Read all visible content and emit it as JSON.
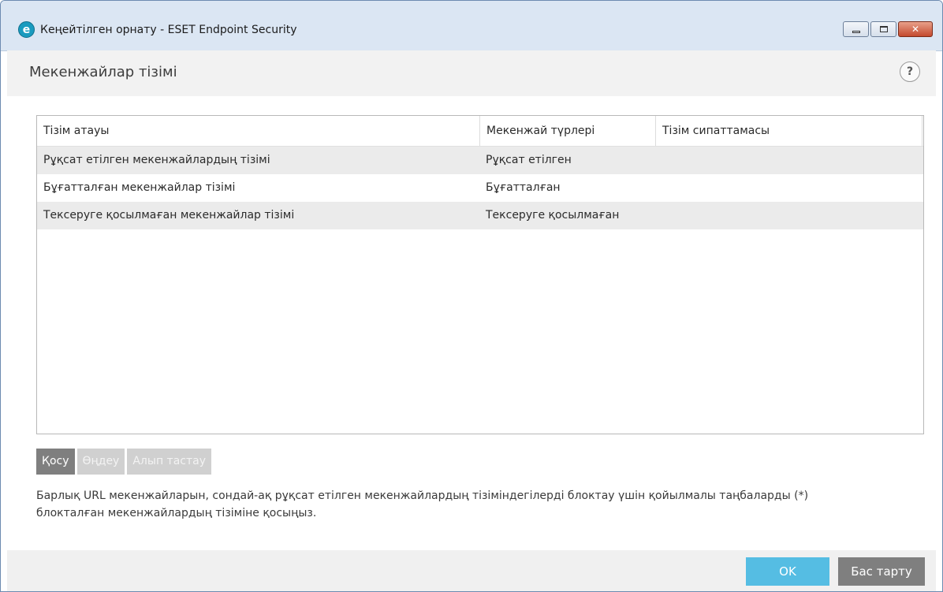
{
  "window": {
    "title": "Кеңейтілген орнату - ESET Endpoint Security",
    "logo_letter": "e",
    "controls": {
      "minimize": "",
      "maximize": "",
      "close": "✕"
    }
  },
  "header": {
    "title": "Мекенжайлар тізімі",
    "help_label": "?"
  },
  "table": {
    "columns": [
      "Тізім атауы",
      "Мекенжай түрлері",
      "Тізім сипаттамасы"
    ],
    "rows": [
      {
        "name": "Рұқсат етілген мекенжайлардың тізімі",
        "type": "Рұқсат етілген",
        "description": ""
      },
      {
        "name": "Бұғатталған мекенжайлар тізімі",
        "type": "Бұғатталған",
        "description": ""
      },
      {
        "name": "Тексеруге қосылмаған мекенжайлар тізімі",
        "type": "Тексеруге қосылмаған",
        "description": ""
      }
    ]
  },
  "actions": {
    "add": "Қосу",
    "edit": "Өңдеу",
    "remove": "Алып тастау"
  },
  "note": {
    "line1": "Барлық URL мекенжайларын, сондай-ақ рұқсат етілген мекенжайлардың тізіміндегілерді блоктау үшін қойылмалы таңбаларды (*)",
    "line2": "блокталған мекенжайлардың тізіміне қосыңыз."
  },
  "footer": {
    "ok": "OK",
    "cancel": "Бас тарту"
  },
  "colors": {
    "accent": "#55bde3",
    "button_gray": "#7f7f7f",
    "row_alt": "#ebebeb"
  }
}
